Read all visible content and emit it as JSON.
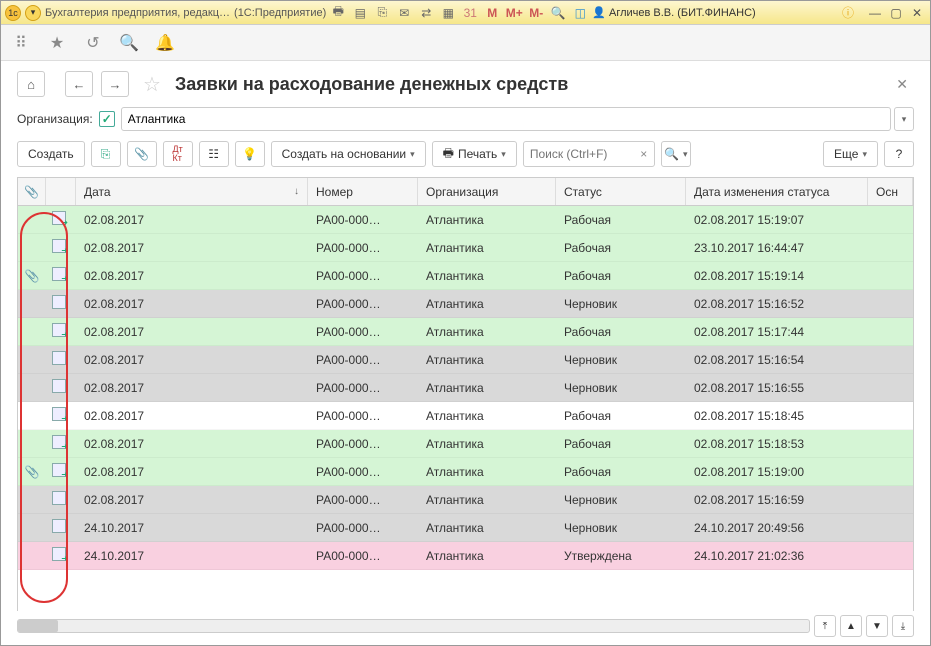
{
  "titlebar": {
    "app_title": "Бухгалтерия предприятия, редакц…",
    "platform": "(1С:Предприятие)",
    "user_label": "Агличев В.В. (БИТ.ФИНАНС)",
    "m_label": "M",
    "m_plus_label": "M+",
    "m_minus_label": "M-"
  },
  "page": {
    "title": "Заявки на расходование денежных средств"
  },
  "org": {
    "label": "Организация:",
    "value": "Атлантика"
  },
  "actions": {
    "create": "Создать",
    "create_based": "Создать на основании",
    "print": "Печать",
    "search_placeholder": "Поиск (Ctrl+F)",
    "more": "Еще"
  },
  "columns": {
    "attach": "",
    "date": "Дата",
    "number": "Номер",
    "org": "Организация",
    "status": "Статус",
    "changed": "Дата изменения статуса",
    "rest": "Осн"
  },
  "rows": [
    {
      "attach": false,
      "arrow": true,
      "date": "02.08.2017",
      "num": "РА00-000…",
      "org": "Атлантика",
      "status": "Рабочая",
      "changed": "02.08.2017 15:19:07",
      "cls": "row-green"
    },
    {
      "attach": false,
      "arrow": true,
      "date": "02.08.2017",
      "num": "РА00-000…",
      "org": "Атлантика",
      "status": "Рабочая",
      "changed": "23.10.2017 16:44:47",
      "cls": "row-green"
    },
    {
      "attach": true,
      "arrow": true,
      "date": "02.08.2017",
      "num": "РА00-000…",
      "org": "Атлантика",
      "status": "Рабочая",
      "changed": "02.08.2017 15:19:14",
      "cls": "row-green"
    },
    {
      "attach": false,
      "arrow": false,
      "date": "02.08.2017",
      "num": "РА00-000…",
      "org": "Атлантика",
      "status": "Черновик",
      "changed": "02.08.2017 15:16:52",
      "cls": "row-grey"
    },
    {
      "attach": false,
      "arrow": true,
      "date": "02.08.2017",
      "num": "РА00-000…",
      "org": "Атлантика",
      "status": "Рабочая",
      "changed": "02.08.2017 15:17:44",
      "cls": "row-green"
    },
    {
      "attach": false,
      "arrow": false,
      "date": "02.08.2017",
      "num": "РА00-000…",
      "org": "Атлантика",
      "status": "Черновик",
      "changed": "02.08.2017 15:16:54",
      "cls": "row-grey"
    },
    {
      "attach": false,
      "arrow": false,
      "date": "02.08.2017",
      "num": "РА00-000…",
      "org": "Атлантика",
      "status": "Черновик",
      "changed": "02.08.2017 15:16:55",
      "cls": "row-grey"
    },
    {
      "attach": false,
      "arrow": true,
      "date": "02.08.2017",
      "num": "РА00-000…",
      "org": "Атлантика",
      "status": "Рабочая",
      "changed": "02.08.2017 15:18:45",
      "cls": "row-white"
    },
    {
      "attach": false,
      "arrow": true,
      "date": "02.08.2017",
      "num": "РА00-000…",
      "org": "Атлантика",
      "status": "Рабочая",
      "changed": "02.08.2017 15:18:53",
      "cls": "row-green"
    },
    {
      "attach": true,
      "arrow": true,
      "date": "02.08.2017",
      "num": "РА00-000…",
      "org": "Атлантика",
      "status": "Рабочая",
      "changed": "02.08.2017 15:19:00",
      "cls": "row-green"
    },
    {
      "attach": false,
      "arrow": false,
      "date": "02.08.2017",
      "num": "РА00-000…",
      "org": "Атлантика",
      "status": "Черновик",
      "changed": "02.08.2017 15:16:59",
      "cls": "row-grey"
    },
    {
      "attach": false,
      "arrow": false,
      "date": "24.10.2017",
      "num": "РА00-000…",
      "org": "Атлантика",
      "status": "Черновик",
      "changed": "24.10.2017 20:49:56",
      "cls": "row-grey"
    },
    {
      "attach": false,
      "arrow": true,
      "date": "24.10.2017",
      "num": "РА00-000…",
      "org": "Атлантика",
      "status": "Утверждена",
      "changed": "24.10.2017 21:02:36",
      "cls": "row-pink"
    }
  ]
}
